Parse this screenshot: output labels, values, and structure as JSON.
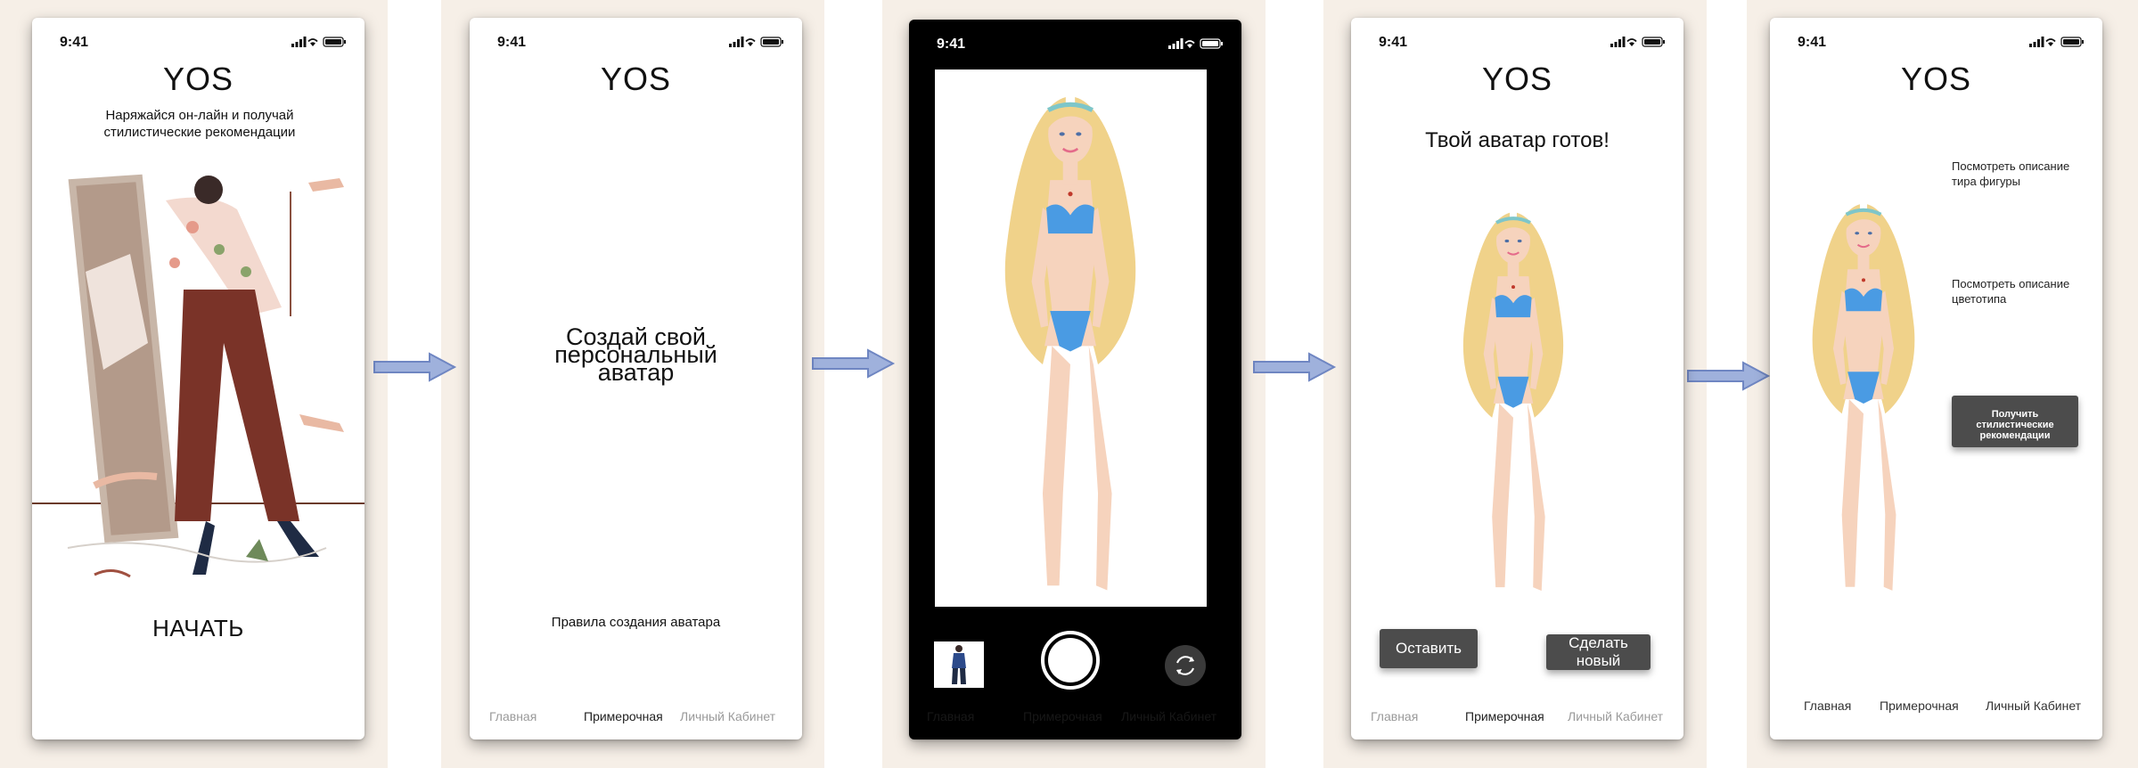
{
  "status_time": "9:41",
  "logo": "YOS",
  "screen1": {
    "tagline": "Наряжайся он-лайн и получай стилистические рекомендации",
    "start_label": "НАЧАТЬ"
  },
  "screen2": {
    "heading": "Создай свой персональный аватар",
    "rules_link": "Правила создания аватара",
    "tabs": [
      "Главная",
      "Примерочная",
      "Личный Кабинет"
    ]
  },
  "screen3": {
    "tabs": [
      "Главная",
      "Примерочная",
      "Личный Кабинет"
    ]
  },
  "screen4": {
    "heading": "Твой аватар готов!",
    "keep_label": "Оставить",
    "new_label": "Сделать новый",
    "tabs": [
      "Главная",
      "Примерочная",
      "Личный Кабинет"
    ]
  },
  "screen5": {
    "body_type_link": "Посмотреть описание тира фигуры",
    "color_type_link": "Посмотреть описание цветотипа",
    "get_recs_label": "Получить стилистические рекомендации",
    "tabs": [
      "Главная",
      "Примерочная",
      "Личный Кабинет"
    ]
  },
  "colors": {
    "page_bg": "#f6efe7",
    "arrow_fill": "#9fb1dc",
    "arrow_stroke": "#6f86c2",
    "button": "#4c4c4c",
    "swimsuit": "#4a9be3"
  }
}
